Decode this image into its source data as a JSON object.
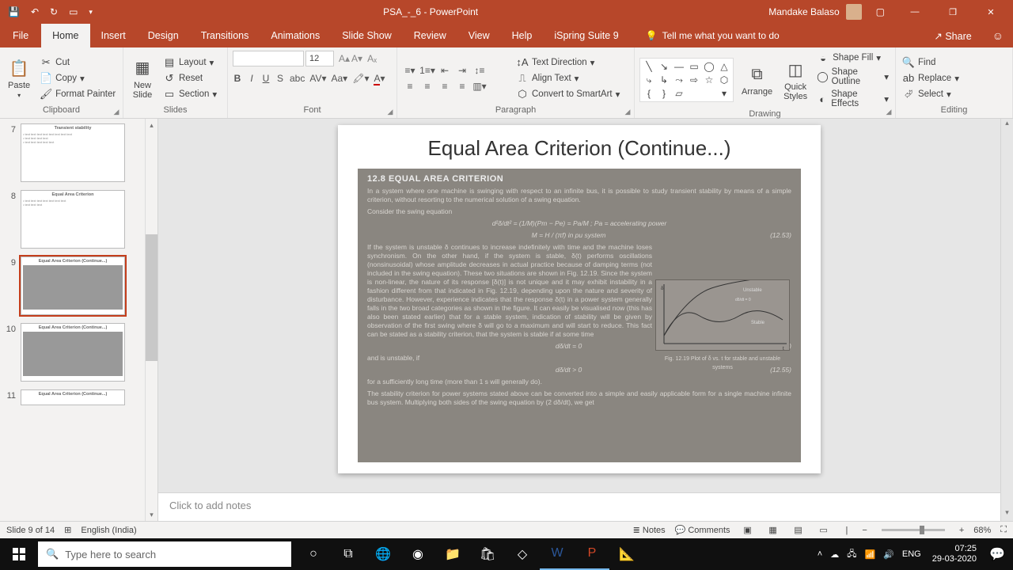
{
  "titlebar": {
    "title": "PSA_-_6 - PowerPoint",
    "user": "Mandake Balaso"
  },
  "tabs": {
    "file": "File",
    "home": "Home",
    "insert": "Insert",
    "design": "Design",
    "transitions": "Transitions",
    "animations": "Animations",
    "slideshow": "Slide Show",
    "review": "Review",
    "view": "View",
    "help": "Help",
    "ispring": "iSpring Suite 9",
    "tellme": "Tell me what you want to do",
    "share": "Share"
  },
  "ribbon": {
    "clipboard": {
      "label": "Clipboard",
      "paste": "Paste",
      "cut": "Cut",
      "copy": "Copy",
      "painter": "Format Painter"
    },
    "slides": {
      "label": "Slides",
      "new": "New\nSlide",
      "layout": "Layout",
      "reset": "Reset",
      "section": "Section"
    },
    "font": {
      "label": "Font",
      "size": "12"
    },
    "paragraph": {
      "label": "Paragraph",
      "textdir": "Text Direction",
      "align": "Align Text",
      "smartart": "Convert to SmartArt"
    },
    "drawing": {
      "label": "Drawing",
      "arrange": "Arrange",
      "quick": "Quick\nStyles",
      "fill": "Shape Fill",
      "outline": "Shape Outline",
      "effects": "Shape Effects"
    },
    "editing": {
      "label": "Editing",
      "find": "Find",
      "replace": "Replace",
      "select": "Select"
    }
  },
  "thumbs": {
    "n7": "7",
    "n8": "8",
    "n9": "9",
    "n10": "10",
    "n11": "11",
    "t7": "Transient stability",
    "t8": "Equal Area Criterion",
    "t9": "Equal Area Criterion (Continue...)",
    "t10": "Equal Area Criterion (Continue...)",
    "t11": "Equal Area Criterion (Continue...)"
  },
  "slide": {
    "title": "Equal Area Criterion (Continue...)",
    "section": "12.8   EQUAL AREA CRITERION",
    "p1": "In a system where one machine is swinging with respect to an infinite bus, it is possible to study transient stability by means of a simple criterion, without resorting to the numerical solution of a swing equation.",
    "p1b": "Consider the swing equation",
    "eq1": "d²δ/dt² = (1/M)(Pm − Pe) = Pa/M ;  Pa = accelerating power",
    "eq2": "M = H / (πf)   in pu system",
    "eqnum1": "(12.53)",
    "p2": "If the system is unstable δ continues to increase indefinitely with time and the machine loses synchronism. On the other hand, if the system is stable, δ(t) performs oscillations (nonsinusoidal) whose amplitude decreases in actual practice because of damping terms (not included in the swing equation). These two situations are shown in Fig. 12.19. Since the system is non-linear, the nature of its response [δ(t)] is not unique and it may exhibit instability in a fashion different from that indicated in Fig. 12.19, depending upon the nature and severity of disturbance. However, experience indicates that the response δ(t) in a power system generally falls in the two broad categories as shown in the figure. It can easily be visualised now (this has also been stated earlier) that for a stable system, indication of stability will be given by observation of the first swing where δ will go to a maximum and will start to reduce. This fact can be stated as a stability criterion, that the system is stable if at some time",
    "eq3": "dδ/dt = 0",
    "eqnum2": "(12.54)",
    "p3": "and is unstable, if",
    "eq4": "dδ/dt > 0",
    "eqnum3": "(12.55)",
    "p4": "for a sufficiently long time (more than 1 s will generally do).",
    "p5": "The stability criterion for power systems stated above can be converted into a simple and easily applicable form for a single machine infinite bus system. Multiplying both sides of the swing equation by (2 dδ/dt), we get",
    "figlabel": "Fig. 12.19   Plot of δ vs. t for stable and unstable systems",
    "figun": "Unstable",
    "figst": "Stable",
    "figax": "dδ/dt = 0"
  },
  "notes": {
    "placeholder": "Click to add notes"
  },
  "status": {
    "slide": "Slide 9 of 14",
    "lang": "English (India)",
    "notes": "Notes",
    "comments": "Comments",
    "zoom": "68%"
  },
  "taskbar": {
    "search": "Type here to search",
    "kb": "ENG",
    "time": "07:25",
    "date": "29-03-2020"
  }
}
